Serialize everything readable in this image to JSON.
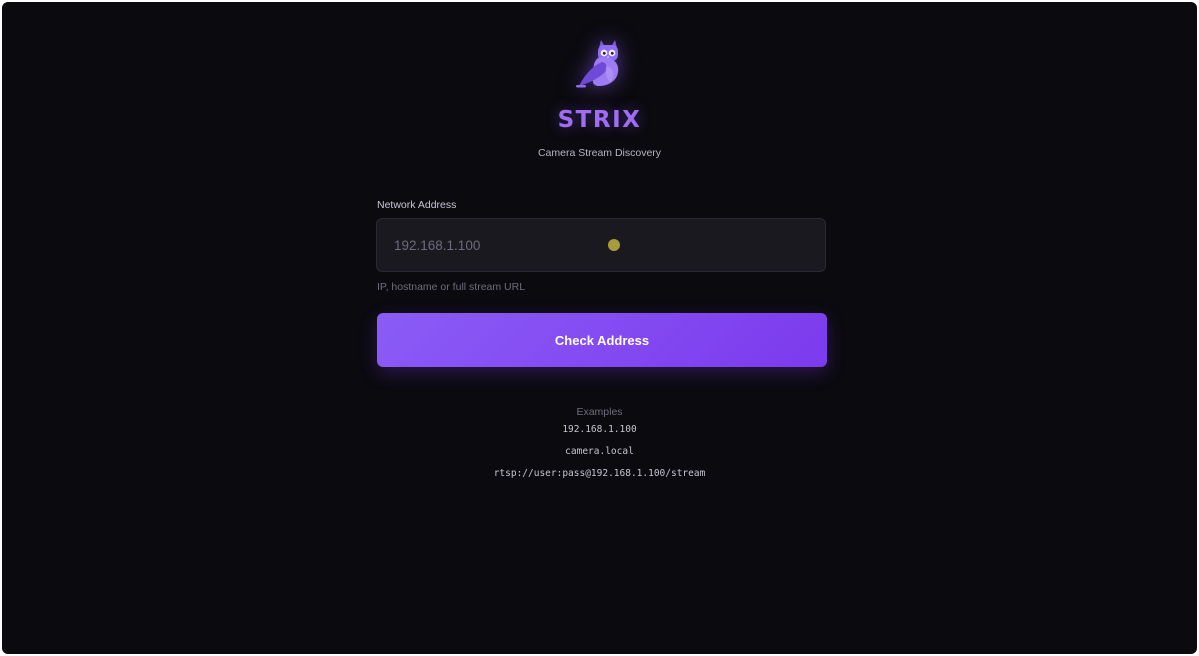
{
  "app": {
    "title": "STRIX",
    "subtitle": "Camera Stream Discovery",
    "logo_icon": "owl-icon"
  },
  "form": {
    "address_label": "Network Address",
    "address_value": "",
    "address_placeholder": "192.168.1.100",
    "address_hint": "IP, hostname or full stream URL",
    "submit_label": "Check Address"
  },
  "examples": {
    "heading": "Examples",
    "items": [
      "192.168.1.100",
      "camera.local",
      "rtsp://user:pass@192.168.1.100/stream"
    ]
  },
  "colors": {
    "background": "#0b0a0f",
    "accent": "#8b5cf6",
    "accent_dark": "#7c3aed",
    "title": "#a06cf4",
    "input_bg": "#1a1920",
    "muted_text": "#6f6c7c"
  }
}
